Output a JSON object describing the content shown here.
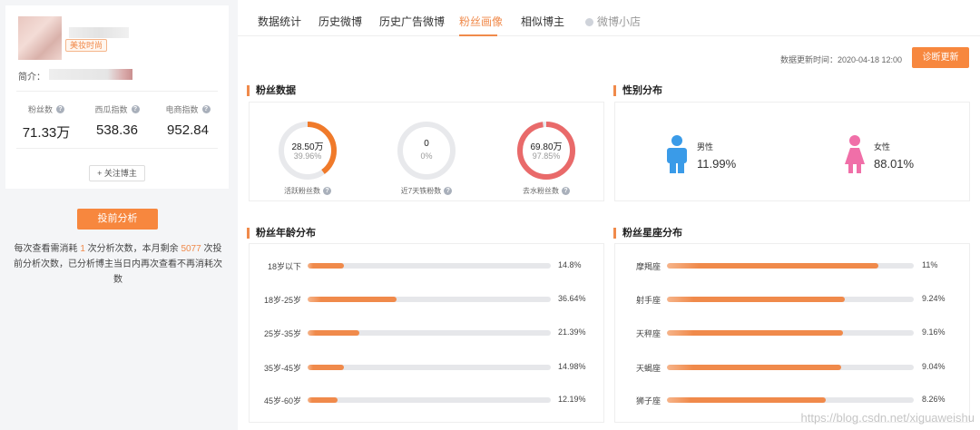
{
  "profile": {
    "tag": "美妆时尚",
    "intro_label": "简介：",
    "stats": [
      {
        "label": "粉丝数",
        "value": "71.33万"
      },
      {
        "label": "西瓜指数",
        "value": "538.36"
      },
      {
        "label": "电商指数",
        "value": "952.84"
      }
    ],
    "follow_label": "+ 关注博主"
  },
  "analysis": {
    "button_label": "投前分析",
    "notice_part1": "每次查看需消耗 ",
    "notice_cost": "1",
    "notice_part2": " 次分析次数，本月剩余 ",
    "notice_remaining": "5077",
    "notice_part3": " 次投前分析次数，已分析博主当日内再次查看不再消耗次数"
  },
  "tabs": [
    {
      "label": "数据统计"
    },
    {
      "label": "历史微博"
    },
    {
      "label": "历史广告微博"
    },
    {
      "label": "粉丝画像"
    },
    {
      "label": "相似博主"
    },
    {
      "label": "微博小店"
    }
  ],
  "update": {
    "time_text": "数据更新时间：2020-04-18 12:00",
    "diag_button": "诊断更新"
  },
  "fans_data": {
    "title": "粉丝数据",
    "items": [
      {
        "value": "28.50万",
        "pct": "39.96%",
        "label": "活跃粉丝数",
        "ratio": 0.3996,
        "color": "#f07a2a"
      },
      {
        "value": "0",
        "pct": "0%",
        "label": "近7天铁粉数",
        "ratio": 0,
        "color": "#f07a2a"
      },
      {
        "value": "69.80万",
        "pct": "97.85%",
        "label": "去水粉丝数",
        "ratio": 0.9785,
        "color": "#e96a6a"
      }
    ]
  },
  "gender": {
    "title": "性别分布",
    "male_label": "男性",
    "male_value": "11.99%",
    "female_label": "女性",
    "female_value": "88.01%",
    "male_color": "#3a9be8",
    "female_color": "#f06fa8"
  },
  "age": {
    "title": "粉丝年龄分布",
    "rows": [
      {
        "label": "18岁以下",
        "pct": "14.8%",
        "value": 0.148
      },
      {
        "label": "18岁-25岁",
        "pct": "36.64%",
        "value": 0.3664
      },
      {
        "label": "25岁-35岁",
        "pct": "21.39%",
        "value": 0.2139
      },
      {
        "label": "35岁-45岁",
        "pct": "14.98%",
        "value": 0.1498
      },
      {
        "label": "45岁-60岁",
        "pct": "12.19%",
        "value": 0.1219
      }
    ]
  },
  "zodiac": {
    "title": "粉丝星座分布",
    "rows": [
      {
        "label": "摩羯座",
        "pct": "11%",
        "value": 0.11
      },
      {
        "label": "射手座",
        "pct": "9.24%",
        "value": 0.0924
      },
      {
        "label": "天秤座",
        "pct": "9.16%",
        "value": 0.0916
      },
      {
        "label": "天蝎座",
        "pct": "9.04%",
        "value": 0.0904
      },
      {
        "label": "狮子座",
        "pct": "8.26%",
        "value": 0.0826
      }
    ]
  },
  "watermark": "https://blog.csdn.net/xiguaweishu"
}
